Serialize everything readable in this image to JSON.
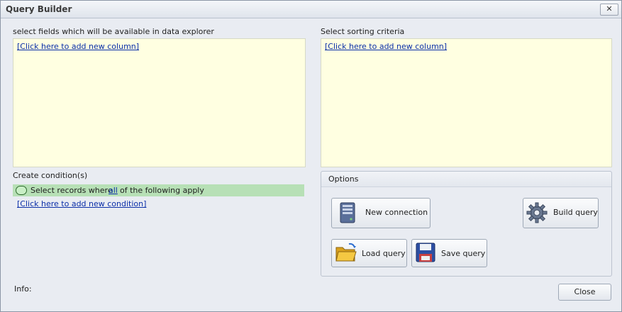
{
  "window": {
    "title": "Query Builder",
    "close_glyph": "✕"
  },
  "fields": {
    "label": "select fields which will be available in data explorer",
    "add_link": "[Click here to add new column]"
  },
  "sorting": {
    "label": "Select sorting criteria",
    "add_link": "[Click here to add new column]"
  },
  "conditions": {
    "label": "Create condition(s)",
    "row_prefix": "Select records where",
    "row_quantifier": "all",
    "row_suffix": "of the following apply",
    "add_link": "[Click here to add new condition]"
  },
  "options": {
    "title": "Options",
    "new_connection": "New connection",
    "build_query": "Build query",
    "load_query": "Load query",
    "save_query": "Save query"
  },
  "footer": {
    "info_label": "Info:",
    "close_button": "Close"
  },
  "colors": {
    "panel_bg": "#ffffe1",
    "condition_bg": "#b7e0b6",
    "link": "#0b2fa8"
  },
  "icons": {
    "new_connection": "server-icon",
    "build_query": "gear-icon",
    "load_query": "open-folder-icon",
    "save_query": "floppy-disk-icon"
  }
}
